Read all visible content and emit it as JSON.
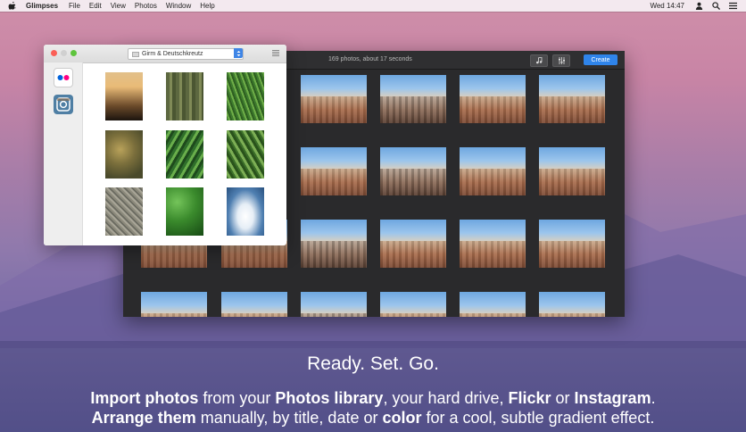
{
  "menubar": {
    "app_name": "Glimpses",
    "items": [
      "File",
      "Edit",
      "View",
      "Photos",
      "Window",
      "Help"
    ],
    "clock": "Wed 14:47"
  },
  "main_window": {
    "info": "169 photos, about 17 seconds",
    "create_label": "Create",
    "icons": [
      "music-note-icon",
      "sliders-icon"
    ]
  },
  "import_panel": {
    "album": "Girm & Deutschkreutz",
    "sources": [
      "flickr-icon",
      "instagram-icon"
    ]
  },
  "caption": {
    "headline": "Ready. Set. Go.",
    "line1": {
      "b1": "Import photos",
      "t1": " from your ",
      "b2": "Photos library",
      "t2": ", your hard drive, ",
      "b3": "Flickr",
      "t3": " or ",
      "b4": "Instagram",
      "t4": "."
    },
    "line2": {
      "b1": "Arrange them",
      "t1": " manually, by title, date or ",
      "b2": "color",
      "t2": " for a cool, subtle gradient effect."
    }
  },
  "colors": {
    "accent": "#2f84ea",
    "window_bg": "#2a2a2c"
  }
}
